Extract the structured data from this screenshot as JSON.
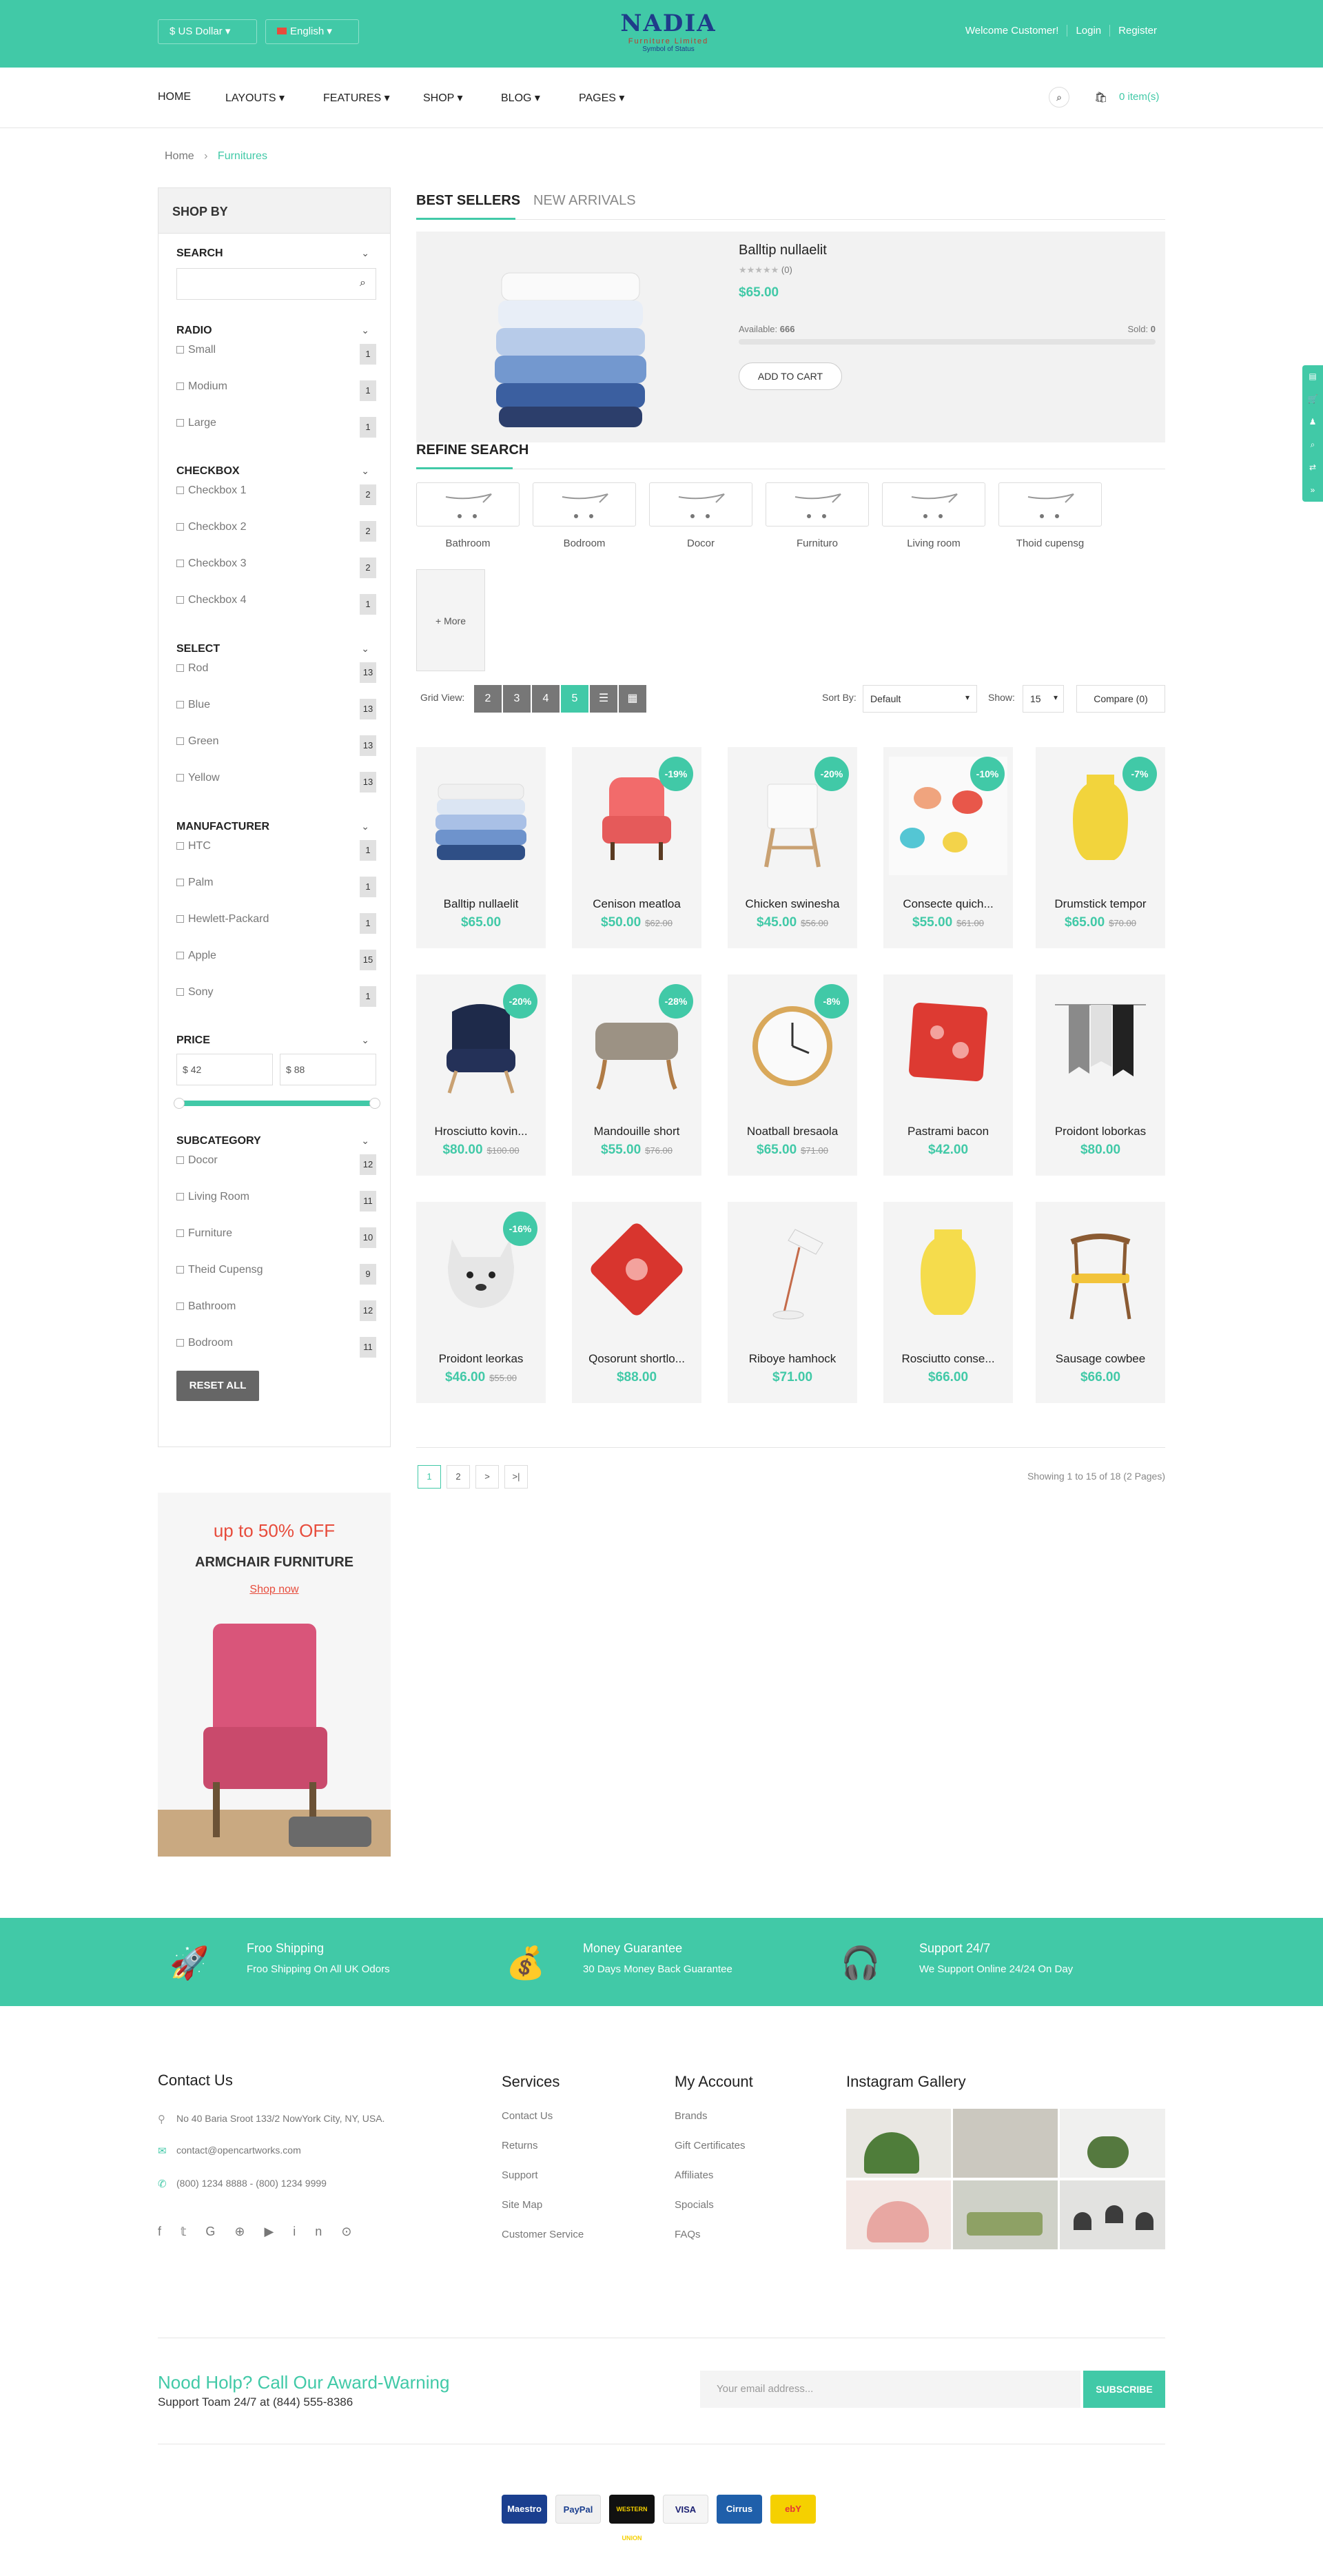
{
  "topbar": {
    "currency": "$ US Dollar",
    "language": "English",
    "logo_title": "NADIA",
    "logo_sub": "Furniture Limited",
    "logo_tag": "Symbol of Status",
    "welcome": "Welcome Customer!",
    "login": "Login",
    "register": "Register"
  },
  "nav": {
    "items": [
      "HOME",
      "LAYOUTS",
      "FEATURES",
      "SHOP",
      "BLOG",
      "PAGES"
    ],
    "cart": "0 item(s)"
  },
  "breadcrumb": {
    "home": "Home",
    "current": "Furnitures"
  },
  "sidebar": {
    "title": "SHOP BY",
    "search_title": "SEARCH",
    "radio": {
      "title": "RADIO",
      "options": [
        [
          "Small",
          "1"
        ],
        [
          "Modium",
          "1"
        ],
        [
          "Large",
          "1"
        ]
      ]
    },
    "checkbox": {
      "title": "CHECKBOX",
      "options": [
        [
          "Checkbox 1",
          "2"
        ],
        [
          "Checkbox 2",
          "2"
        ],
        [
          "Checkbox 3",
          "2"
        ],
        [
          "Checkbox 4",
          "1"
        ]
      ]
    },
    "select": {
      "title": "SELECT",
      "options": [
        [
          "Rod",
          "13"
        ],
        [
          "Blue",
          "13"
        ],
        [
          "Green",
          "13"
        ],
        [
          "Yellow",
          "13"
        ]
      ]
    },
    "manufacturer": {
      "title": "MANUFACTURER",
      "options": [
        [
          "HTC",
          "1"
        ],
        [
          "Palm",
          "1"
        ],
        [
          "Hewlett-Packard",
          "1"
        ],
        [
          "Apple",
          "15"
        ],
        [
          "Sony",
          "1"
        ]
      ]
    },
    "price": {
      "title": "PRICE",
      "min": "42",
      "max": "88",
      "currency": "$"
    },
    "subcategory": {
      "title": "SUBCATEGORY",
      "options": [
        [
          "Docor",
          "12"
        ],
        [
          "Living Room",
          "11"
        ],
        [
          "Furniture",
          "10"
        ],
        [
          "Theid Cupensg",
          "9"
        ],
        [
          "Bathroom",
          "12"
        ],
        [
          "Bodroom",
          "11"
        ]
      ]
    },
    "reset": "RESET ALL"
  },
  "banner": {
    "offer": "up to 50% OFF",
    "title": "ARMCHAIR FURNITURE",
    "link": "Shop now"
  },
  "tabs": {
    "active": "BEST SELLERS",
    "other": "NEW ARRIVALS"
  },
  "featured": {
    "name": "Balltip nullaelit",
    "reviews": "(0)",
    "price": "$65.00",
    "available_label": "Available:",
    "available": "666",
    "sold_label": "Sold:",
    "sold": "0",
    "button": "ADD TO CART"
  },
  "refine": {
    "title": "REFINE SEARCH",
    "categories": [
      "Bathroom",
      "Bodroom",
      "Docor",
      "Furnituro",
      "Living room",
      "Thoid cupensg"
    ],
    "more": "+ More"
  },
  "toolbar": {
    "grid_label": "Grid View:",
    "grid_opts": [
      "2",
      "3",
      "4",
      "5"
    ],
    "sort_label": "Sort By:",
    "sort_value": "Default",
    "show_label": "Show:",
    "show_value": "15",
    "compare": "Compare (0)"
  },
  "products": [
    {
      "name": "Balltip nullaelit",
      "price": "$65.00",
      "old": "",
      "badge": ""
    },
    {
      "name": "Cenison meatloa",
      "price": "$50.00",
      "old": "$62.00",
      "badge": "-19%"
    },
    {
      "name": "Chicken swinesha",
      "price": "$45.00",
      "old": "$56.00",
      "badge": "-20%"
    },
    {
      "name": "Consecte quich...",
      "price": "$55.00",
      "old": "$61.00",
      "badge": "-10%"
    },
    {
      "name": "Drumstick tempor",
      "price": "$65.00",
      "old": "$70.00",
      "badge": "-7%"
    },
    {
      "name": "Hrosciutto kovin...",
      "price": "$80.00",
      "old": "$100.00",
      "badge": "-20%"
    },
    {
      "name": "Mandouille short",
      "price": "$55.00",
      "old": "$76.00",
      "badge": "-28%"
    },
    {
      "name": "Noatball bresaola",
      "price": "$65.00",
      "old": "$71.00",
      "badge": "-8%"
    },
    {
      "name": "Pastrami bacon",
      "price": "$42.00",
      "old": "",
      "badge": ""
    },
    {
      "name": "Proidont loborkas",
      "price": "$80.00",
      "old": "",
      "badge": ""
    },
    {
      "name": "Proidont leorkas",
      "price": "$46.00",
      "old": "$55.00",
      "badge": "-16%"
    },
    {
      "name": "Qosorunt shortlo...",
      "price": "$88.00",
      "old": "",
      "badge": ""
    },
    {
      "name": "Riboye hamhock",
      "price": "$71.00",
      "old": "",
      "badge": ""
    },
    {
      "name": "Rosciutto conse...",
      "price": "$66.00",
      "old": "",
      "badge": ""
    },
    {
      "name": "Sausage cowbee",
      "price": "$66.00",
      "old": "",
      "badge": ""
    }
  ],
  "pagination": {
    "pages": [
      "1",
      "2",
      ">",
      ">|"
    ],
    "summary": "Showing 1 to 15 of 18 (2 Pages)"
  },
  "promo": [
    {
      "title": "Froo Shipping",
      "sub": "Froo Shipping On All UK Odors"
    },
    {
      "title": "Money Guarantee",
      "sub": "30 Days Money Back Guarantee"
    },
    {
      "title": "Support 24/7",
      "sub": "We Support Online 24/24 On Day"
    }
  ],
  "contact": {
    "title": "Contact Us",
    "address": "No 40 Baria Sroot 133/2 NowYork City, NY, USA.",
    "email": "contact@opencartworks.com",
    "phone": "(800) 1234 8888 - (800) 1234 9999"
  },
  "services": {
    "title": "Services",
    "links": [
      "Contact Us",
      "Returns",
      "Support",
      "Site Map",
      "Customer Service"
    ]
  },
  "account": {
    "title": "My Account",
    "links": [
      "Brands",
      "Gift Certificates",
      "Affiliates",
      "Spocials",
      "FAQs"
    ]
  },
  "instagram": {
    "title": "Instagram Gallery"
  },
  "newsletter": {
    "title": "Nood Holp? Call Our Award-Warning",
    "sub": "Support Toam 24/7 at (844) 555-8386",
    "placeholder": "Your email address...",
    "button": "SUBSCRIBE"
  },
  "payments": [
    "Maestro",
    "PayPal",
    "WESTERN UNION",
    "VISA",
    "Cirrus",
    "ebY"
  ],
  "colors": {
    "accent": "#41c9a7",
    "sale": "#e74c3c"
  }
}
